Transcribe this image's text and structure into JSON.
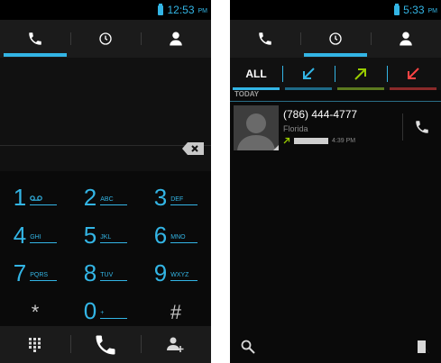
{
  "phone1": {
    "status_time": "12:53",
    "status_ampm": "PM",
    "tabs": [
      {
        "icon": "phone-icon",
        "selected": true
      },
      {
        "icon": "clock-icon",
        "selected": false
      },
      {
        "icon": "contact-icon",
        "selected": false
      }
    ],
    "keypad": [
      {
        "digit": "1",
        "letters": ""
      },
      {
        "digit": "2",
        "letters": "ABC"
      },
      {
        "digit": "3",
        "letters": "DEF"
      },
      {
        "digit": "4",
        "letters": "GHI"
      },
      {
        "digit": "5",
        "letters": "JKL"
      },
      {
        "digit": "6",
        "letters": "MNO"
      },
      {
        "digit": "7",
        "letters": "PQRS"
      },
      {
        "digit": "8",
        "letters": "TUV"
      },
      {
        "digit": "9",
        "letters": "WXYZ"
      },
      {
        "digit": "*",
        "letters": ""
      },
      {
        "digit": "0",
        "letters": "+"
      },
      {
        "digit": "#",
        "letters": ""
      }
    ]
  },
  "phone2": {
    "status_time": "5:33",
    "status_ampm": "PM",
    "filters": {
      "all": "ALL"
    },
    "section": "TODAY",
    "calls": [
      {
        "number": "(786) 444-4777",
        "location": "Florida",
        "time": "4:39 PM"
      }
    ]
  },
  "colors": {
    "accent": "#33b5e5",
    "incoming": "#33b5e5",
    "outgoing": "#99cc00",
    "missed": "#ff4444"
  }
}
